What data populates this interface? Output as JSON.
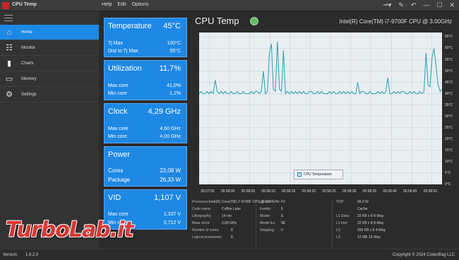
{
  "window": {
    "title": "CPU Temp"
  },
  "menu": {
    "help": "Help",
    "edit": "Edit",
    "options": "Options"
  },
  "sidebar": {
    "items": [
      {
        "label": "Home",
        "icon": "home-icon"
      },
      {
        "label": "Monitor",
        "icon": "monitor-icon"
      },
      {
        "label": "Charts",
        "icon": "charts-icon"
      },
      {
        "label": "Memory",
        "icon": "memory-icon"
      },
      {
        "label": "Settings",
        "icon": "gear-icon"
      }
    ],
    "active": 0
  },
  "panels": {
    "temperature": {
      "title": "Temperature",
      "value": "45°C",
      "rows": [
        {
          "k": "Tj Max",
          "v": "100°C"
        },
        {
          "k": "Dist to Tj Max",
          "v": "55°C"
        }
      ]
    },
    "utilization": {
      "title": "Utilization",
      "value": "11,7%",
      "rows": [
        {
          "k": "Max core",
          "v": "41,0%"
        },
        {
          "k": "Min core",
          "v": "1,1%"
        }
      ]
    },
    "clock": {
      "title": "Clock",
      "value": "4,29 GHz",
      "rows": [
        {
          "k": "Max core",
          "v": "4,60 GHz"
        },
        {
          "k": "Min core",
          "v": "4,00 GHz"
        }
      ]
    },
    "power": {
      "title": "Power",
      "value": "",
      "rows": [
        {
          "k": "Cores",
          "v": "23,08 W"
        },
        {
          "k": "Package",
          "v": "26,33 W"
        }
      ]
    },
    "vid": {
      "title": "VID",
      "value": "1,107 V",
      "rows": [
        {
          "k": "Max core",
          "v": "1,337 V"
        },
        {
          "k": "Min core",
          "v": "0,712 V"
        }
      ]
    }
  },
  "chart_header": {
    "title": "CPU Temp",
    "cpu_name": "Intel(R) Core(TM) i7-9700F CPU @ 3.00GHz"
  },
  "chart_data": {
    "type": "line",
    "title": "",
    "xlabel": "",
    "ylabel": "",
    "x": [
      "05:57:55",
      "05:58:00",
      "05:58:05",
      "05:58:10",
      "05:58:15",
      "05:58:20",
      "05:58:25",
      "05:58:30",
      "05:58:35",
      "05:58:40",
      "05:58:45",
      "05:58:50"
    ],
    "y_ticks": [
      "65°C",
      "60°C",
      "55°C",
      "50°C",
      "45°C",
      "40°C",
      "35°C",
      "30°C",
      "25°C",
      "20°C",
      "15°C",
      "10°C",
      "5°C",
      "0°C"
    ],
    "ylim": [
      0,
      67
    ],
    "series": [
      {
        "name": "CPU Temperature",
        "color": "#2a9fb3",
        "values": [
          40,
          41,
          40,
          40,
          41,
          40,
          41,
          40,
          46,
          41,
          40,
          41,
          40,
          41,
          40,
          40,
          41,
          40,
          40,
          41,
          40,
          40,
          41,
          40,
          40,
          40,
          41,
          40,
          41,
          41,
          40,
          41,
          50,
          40,
          41,
          58,
          62,
          42,
          41,
          63,
          42,
          41,
          59,
          40,
          41,
          40,
          41,
          40,
          41,
          40,
          41,
          40,
          41,
          40,
          40,
          41,
          41,
          40,
          40,
          41,
          40,
          41,
          40,
          40,
          40,
          41,
          40,
          41,
          40,
          40,
          41,
          40,
          41,
          40,
          41,
          40,
          41,
          40,
          40,
          45,
          40,
          41,
          41,
          40,
          40,
          41,
          40,
          40,
          40,
          41,
          40,
          41,
          40,
          41,
          47,
          40,
          40,
          41,
          40,
          41,
          40,
          41,
          41,
          40,
          40,
          41,
          40,
          41,
          40,
          40,
          41,
          40,
          41,
          58,
          44,
          43,
          56,
          60,
          52,
          44,
          41,
          42
        ]
      }
    ],
    "grid": true,
    "legend": "bottom-center",
    "background": "#e9eef1"
  },
  "info": {
    "col1": [
      {
        "k": "Processor:",
        "v": "Intel(R) Core(TM) i7-9700F CPU @ 3.00GHz"
      },
      {
        "k": "Code name:",
        "v": "Coffee Lake"
      },
      {
        "k": "Lithography:",
        "v": "14 nm"
      },
      {
        "k": "Base clock:",
        "v": "3,00 GHz"
      },
      {
        "k": "Number of cores:",
        "v": "8"
      },
      {
        "k": "Logical processors:",
        "v": "8"
      }
    ],
    "col2": [
      {
        "k": "µCode:",
        "v": "F0"
      },
      {
        "k": "Family:",
        "v": "6"
      },
      {
        "k": "Model:",
        "v": "E"
      },
      {
        "k": "Model Ex:",
        "v": "9E"
      },
      {
        "k": "Stepping:",
        "v": "0"
      }
    ],
    "col3": [
      {
        "k": "TDP:",
        "v": "65,0 W"
      },
      {
        "k": "",
        "v": "Cache"
      },
      {
        "k": "L1 Data:",
        "v": "32 KB x 8  8-Way"
      },
      {
        "k": "L1 Inst:",
        "v": "32 KB x 8  8-Way"
      },
      {
        "k": "L2:",
        "v": "256 KB x 8  4-Way"
      },
      {
        "k": "L3:",
        "v": "12 MB  12-Way"
      }
    ]
  },
  "statusbar": {
    "version_label": "Version",
    "version": "1.6.2.0",
    "copyright": "Copyright © 2024 CoderBag LLC"
  },
  "watermark": "TurboLab.it",
  "colors": {
    "accent": "#1e88e5",
    "status_ok": "#66bb6a",
    "line": "#2a9fb3"
  }
}
